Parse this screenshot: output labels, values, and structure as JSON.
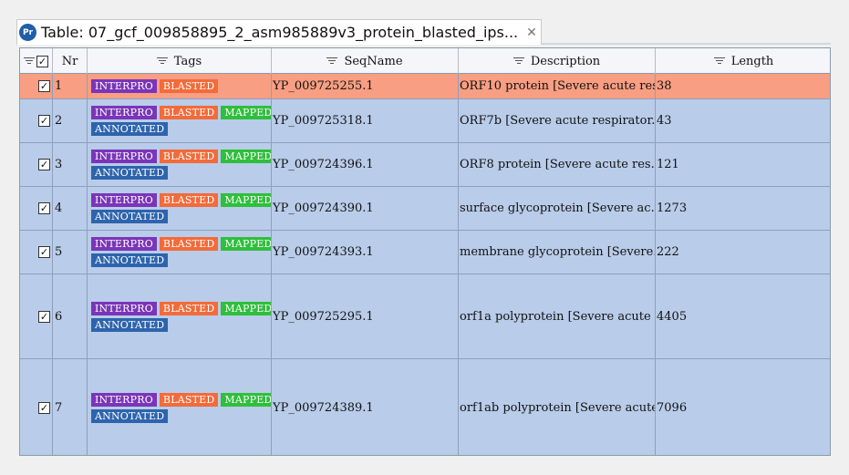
{
  "tab": {
    "icon_text": "Pr",
    "title": "Table: 07_gcf_009858895_2_asm985889v3_protein_blasted_ips...",
    "close": "✕"
  },
  "columns": {
    "select": "",
    "nr": "Nr",
    "tags": "Tags",
    "seqname": "SeqName",
    "description": "Description",
    "length": "Length"
  },
  "tag_colors": {
    "INTERPRO": "#7a35b8",
    "BLASTED": "#f26b3a",
    "MAPPED": "#2fbf3c",
    "ANNOTATED": "#2e64ad"
  },
  "rows": [
    {
      "checked": true,
      "nr": "1",
      "tags": [
        "INTERPRO",
        "BLASTED"
      ],
      "tags2": [],
      "seqname": "YP_009725255.1",
      "description": "ORF10 protein [Severe acute res...",
      "length": "38"
    },
    {
      "checked": true,
      "nr": "2",
      "tags": [
        "INTERPRO",
        "BLASTED",
        "MAPPED"
      ],
      "tags2": [
        "ANNOTATED"
      ],
      "seqname": "YP_009725318.1",
      "description": "ORF7b [Severe acute respirator...",
      "length": "43"
    },
    {
      "checked": true,
      "nr": "3",
      "tags": [
        "INTERPRO",
        "BLASTED",
        "MAPPED"
      ],
      "tags2": [
        "ANNOTATED"
      ],
      "seqname": "YP_009724396.1",
      "description": "ORF8 protein [Severe acute res...",
      "length": "121"
    },
    {
      "checked": true,
      "nr": "4",
      "tags": [
        "INTERPRO",
        "BLASTED",
        "MAPPED"
      ],
      "tags2": [
        "ANNOTATED"
      ],
      "seqname": "YP_009724390.1",
      "description": "surface glycoprotein [Severe ac...",
      "length": "1273"
    },
    {
      "checked": true,
      "nr": "5",
      "tags": [
        "INTERPRO",
        "BLASTED",
        "MAPPED"
      ],
      "tags2": [
        "ANNOTATED"
      ],
      "seqname": "YP_009724393.1",
      "description": "membrane glycoprotein [Severe...",
      "length": "222"
    },
    {
      "checked": true,
      "nr": "6",
      "tags": [
        "INTERPRO",
        "BLASTED",
        "MAPPED"
      ],
      "tags2": [
        "ANNOTATED"
      ],
      "seqname": "YP_009725295.1",
      "description": "orf1a polyprotein [Severe acute ...",
      "length": "4405"
    },
    {
      "checked": true,
      "nr": "7",
      "tags": [
        "INTERPRO",
        "BLASTED",
        "MAPPED"
      ],
      "tags2": [
        "ANNOTATED"
      ],
      "seqname": "YP_009724389.1",
      "description": "orf1ab polyprotein [Severe acute...",
      "length": "7096"
    }
  ]
}
